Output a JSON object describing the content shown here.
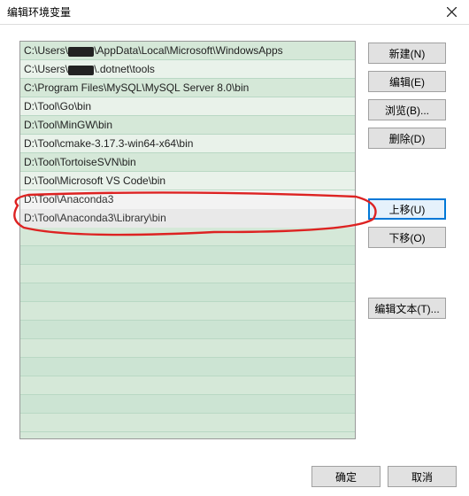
{
  "title": "编辑环境变量",
  "list_items": [
    "C:\\Users\\Lucia\\AppData\\Local\\Microsoft\\WindowsApps",
    "C:\\Users\\Lucia\\.dotnet\\tools",
    "C:\\Program Files\\MySQL\\MySQL Server 8.0\\bin",
    "D:\\Tool\\Go\\bin",
    "D:\\Tool\\MinGW\\bin",
    "D:\\Tool\\cmake-3.17.3-win64-x64\\bin",
    "D:\\Tool\\TortoiseSVN\\bin",
    "D:\\Tool\\Microsoft VS Code\\bin",
    "D:\\Tool\\Anaconda3",
    "D:\\Tool\\Anaconda3\\Library\\bin"
  ],
  "redacted_indexes": [
    0,
    1
  ],
  "highlight_indexes": [
    8,
    9
  ],
  "buttons": {
    "new": "新建(N)",
    "edit": "编辑(E)",
    "browse": "浏览(B)...",
    "delete": "删除(D)",
    "moveup": "上移(U)",
    "movedown": "下移(O)",
    "edittext": "编辑文本(T)..."
  },
  "footer": {
    "ok": "确定",
    "cancel": "取消"
  },
  "active_button": "moveup"
}
